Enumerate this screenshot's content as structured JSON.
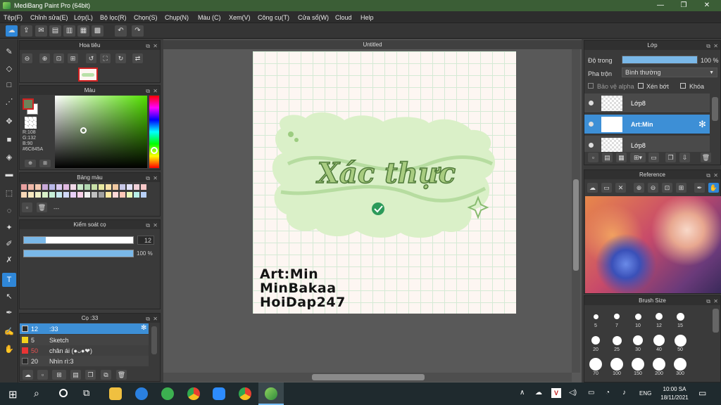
{
  "window": {
    "title": "MediBang Paint Pro (64bit)",
    "controls": [
      "—",
      "❐",
      "✕"
    ]
  },
  "menu": [
    "Tệp(F)",
    "Chỉnh sửa(E)",
    "Lớp(L)",
    "Bộ lọc(R)",
    "Chọn(S)",
    "Chụp(N)",
    "Màu (C)",
    "Xem(V)",
    "Công cụ(T)",
    "Cửa sổ(W)",
    "Cloud",
    "Help"
  ],
  "document": {
    "tab_title": "Untitled"
  },
  "navigator": {
    "title": "Hoa tiêu"
  },
  "color_panel": {
    "title": "Màu",
    "r": "R:108",
    "g": "G:132",
    "b": "B:90",
    "hex": "#6C845A",
    "primary_color": "#6C845A"
  },
  "palette": {
    "title": "Bảng màu",
    "more": "---",
    "colors": [
      "#e8a0a0",
      "#f0b8a8",
      "#f4c8b0",
      "#c8a8d8",
      "#b8b8e8",
      "#d8c8f0",
      "#e0b8e0",
      "#f0d8e8",
      "#c8e8c8",
      "#b0d8b0",
      "#c8e0a8",
      "#e8e8a0",
      "#f8e0a8",
      "#f0c8a0",
      "#c8c8e8",
      "#e0e0f8",
      "#f0d0d8",
      "#f8c8c8",
      "#f8d8b8",
      "#f8e8c0",
      "#f0f0c8",
      "#d8f0c8",
      "#c8f0d8",
      "#c8e8f0",
      "#d0d8f8",
      "#e8d0f8",
      "#f8d0e8",
      "#f0f0f0",
      "#c0c0c0",
      "#a0a0a0",
      "#ffe8a0",
      "#ffd8d8",
      "#ffc8b8",
      "#e8f8b8",
      "#b8f0e8",
      "#b8d0f8"
    ]
  },
  "brush_control": {
    "title": "Kiểm soát cọ",
    "size_value": "12",
    "opacity_value": "100 %",
    "size_fraction": 0.2,
    "opacity_fraction": 1.0
  },
  "brush_list": {
    "title": "Cọ :33",
    "items": [
      {
        "size": "12",
        "name": ":33",
        "color": "#2a2a2a"
      },
      {
        "size": "5",
        "name": "Sketch",
        "color": "#f2d21c"
      },
      {
        "size": "50",
        "name": "chân ái (●ᴗ●❤)",
        "color": "#e83434"
      },
      {
        "size": "20",
        "name": "Nhìn rì:3",
        "color": "#2a2a2a"
      }
    ]
  },
  "canvas_art": {
    "headline": "Xác thực",
    "credits": [
      "Art:Min",
      "MinBakaa",
      "HoiDap247"
    ]
  },
  "layer_panel": {
    "title": "Lớp",
    "opacity_label": "Độ trong",
    "opacity_value": "100 %",
    "opacity_fraction": 1.0,
    "blend_label": "Pha trộn",
    "blend_value": "Bình thường",
    "protect_alpha": "Bảo vệ alpha",
    "clipping": "Xén bớt",
    "lock": "Khóa",
    "layers": [
      {
        "name": "Lớp8",
        "selected": false
      },
      {
        "name": "Art:Min",
        "selected": true
      },
      {
        "name": "Lớp8",
        "selected": false
      }
    ]
  },
  "reference_panel": {
    "title": "Reference"
  },
  "brush_size_panel": {
    "title": "Brush Size",
    "sizes": [
      "5",
      "7",
      "10",
      "12",
      "15",
      "20",
      "25",
      "30",
      "40",
      "50",
      "70",
      "100",
      "150",
      "200",
      "300"
    ]
  },
  "taskbar": {
    "language": "ENG",
    "time": "10:00 SA",
    "date": "18/11/2021"
  }
}
